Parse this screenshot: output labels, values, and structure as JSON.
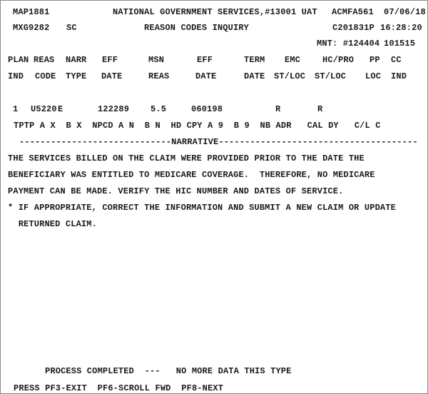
{
  "header": {
    "map_id": "MAP1881",
    "org": "NATIONAL GOVERNMENT SERVICES,#13001 UAT",
    "term_id": "ACMFA561",
    "date": "07/06/18",
    "user_id": "MXG9282",
    "code": "SC",
    "screen_title": "REASON CODES INQUIRY",
    "job": "C201831P",
    "time": "16:28:20",
    "mnt": "MNT: #124404",
    "mnt_num": "101515"
  },
  "columns_row1": [
    "PLAN",
    "REAS",
    "NARR",
    "EFF",
    "MSN",
    "EFF",
    "TERM",
    "EMC",
    "HC/PRO",
    "PP",
    "CC"
  ],
  "columns_row2": [
    "IND",
    "CODE",
    "TYPE",
    "DATE",
    "REAS",
    "DATE",
    "DATE",
    "ST/LOC",
    "ST/LOC",
    "LOC",
    "IND"
  ],
  "record": {
    "plan_ind": "1",
    "reas_code": "U5220",
    "narr_type": "E",
    "eff_date": "122289",
    "msn_reas": "5.5",
    "eff_date2": "060198",
    "emc_st_loc": "R",
    "hc_pro_st_loc": "R"
  },
  "flags_line": "TPTP A X  B X  NPCD A N  B N  HD CPY A 9  B 9  NB ADR   CAL DY   C/L C",
  "narrative_divider": "-----------------------------NARRATIVE--------------------------------------",
  "narrative": [
    "THE SERVICES BILLED ON THE CLAIM WERE PROVIDED PRIOR TO THE DATE THE",
    "BENEFICIARY WAS ENTITLED TO MEDICARE COVERAGE.  THEREFORE, NO MEDICARE",
    "PAYMENT CAN BE MADE. VERIFY THE HIC NUMBER AND DATES OF SERVICE.",
    "* IF APPROPRIATE, CORRECT THE INFORMATION AND SUBMIT A NEW CLAIM OR UPDATE",
    "  RETURNED CLAIM."
  ],
  "status_message": "PROCESS COMPLETED  ---   NO MORE DATA THIS TYPE",
  "function_keys": "PRESS PF3-EXIT  PF6-SCROLL FWD  PF8-NEXT"
}
